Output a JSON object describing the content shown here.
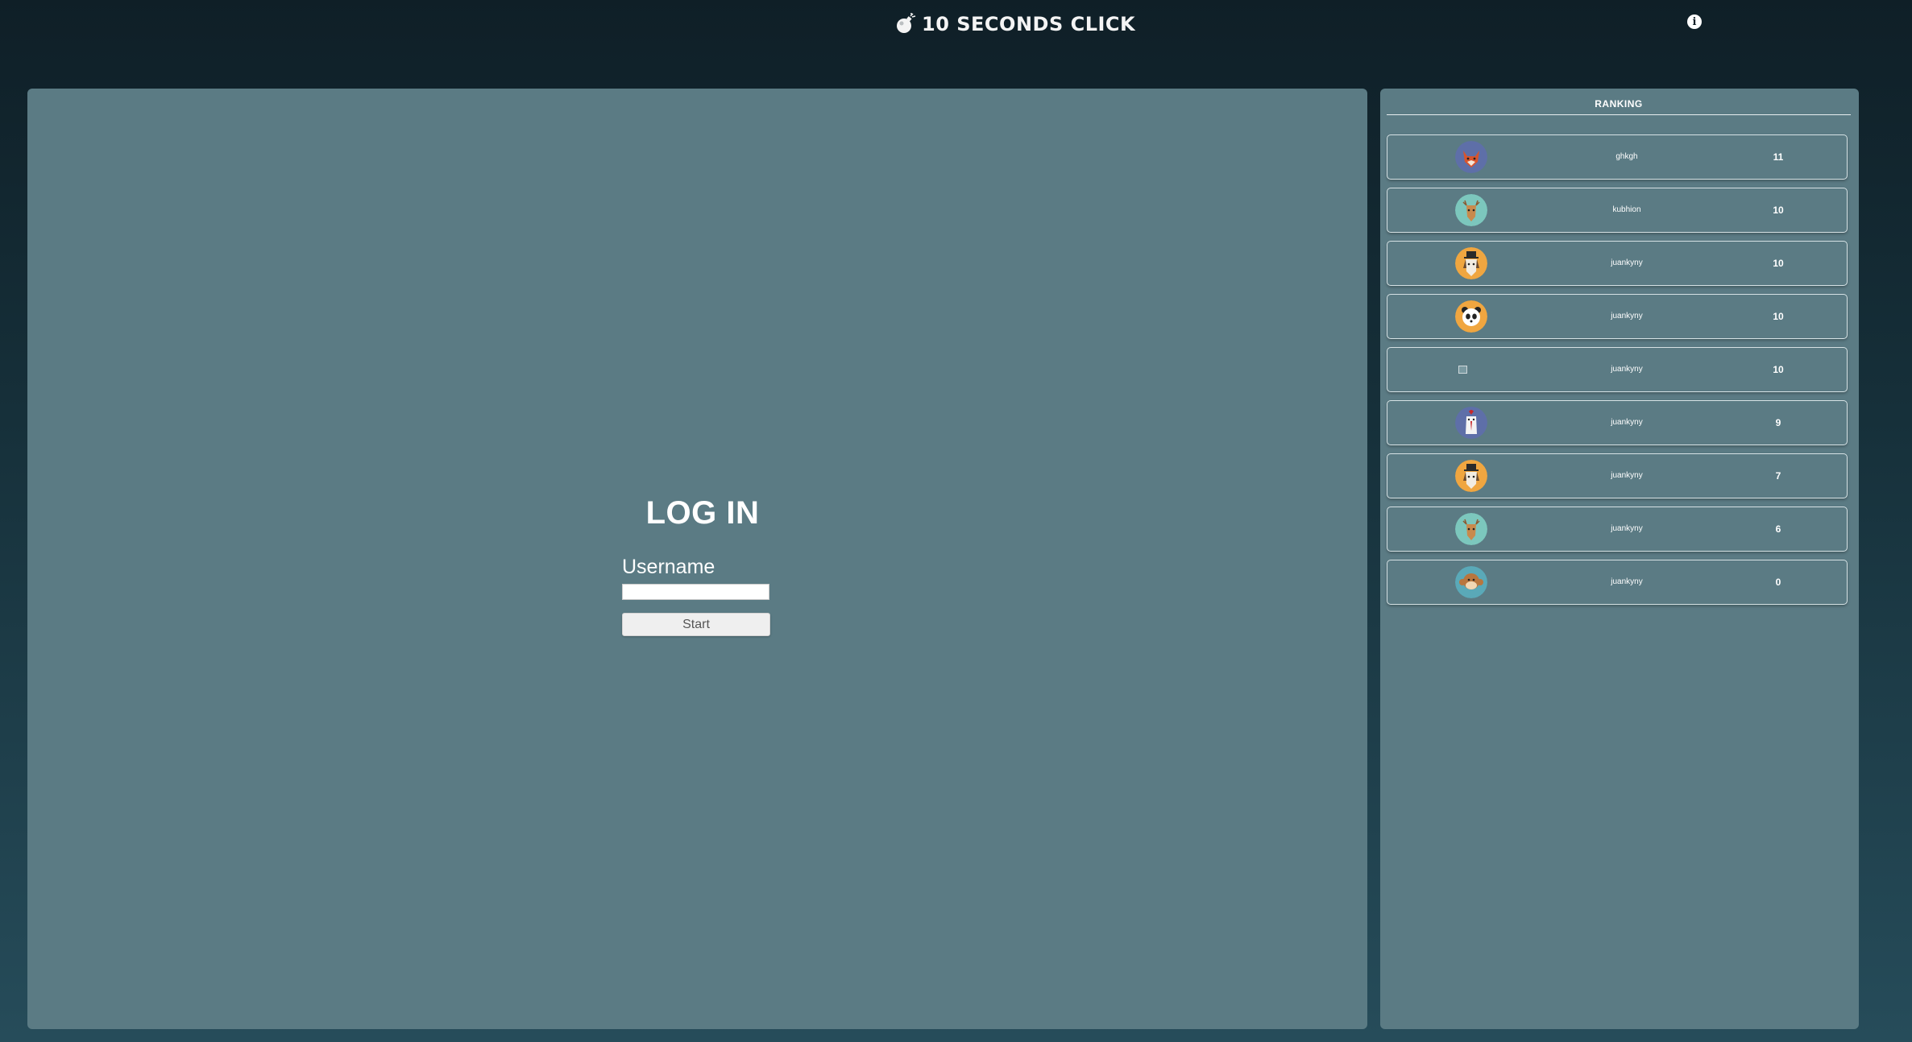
{
  "header": {
    "title": "10 SECONDS CLICK",
    "logo_icon": "bomb-icon",
    "info_icon": "info-icon",
    "info_glyph": "i"
  },
  "login": {
    "heading": "LOG IN",
    "username_label": "Username",
    "username_value": "",
    "start_label": "Start"
  },
  "ranking": {
    "title": "RANKING",
    "entries": [
      {
        "name": "ghkgh",
        "score": "11",
        "avatar": "fox-avatar",
        "avatar_bg": "#5e6fa8"
      },
      {
        "name": "kubhion",
        "score": "10",
        "avatar": "deer-avatar",
        "avatar_bg": "#7cc7bd"
      },
      {
        "name": "juankyny",
        "score": "10",
        "avatar": "dog-top-hat-avatar",
        "avatar_bg": "#f0a640"
      },
      {
        "name": "juankyny",
        "score": "10",
        "avatar": "panda-avatar",
        "avatar_bg": "#f0a640"
      },
      {
        "name": "juankyny",
        "score": "10",
        "avatar": "broken-image-icon",
        "avatar_bg": ""
      },
      {
        "name": "juankyny",
        "score": "9",
        "avatar": "rooster-avatar",
        "avatar_bg": "#5e6fa8"
      },
      {
        "name": "juankyny",
        "score": "7",
        "avatar": "dog-top-hat-avatar",
        "avatar_bg": "#f0a640"
      },
      {
        "name": "juankyny",
        "score": "6",
        "avatar": "deer-avatar",
        "avatar_bg": "#7cc7bd"
      },
      {
        "name": "juankyny",
        "score": "0",
        "avatar": "monkey-avatar",
        "avatar_bg": "#5aa9b8"
      }
    ]
  },
  "colors": {
    "panel": "#5b7b84",
    "background_top": "#0f1f27",
    "background_bottom": "#264c5a"
  }
}
